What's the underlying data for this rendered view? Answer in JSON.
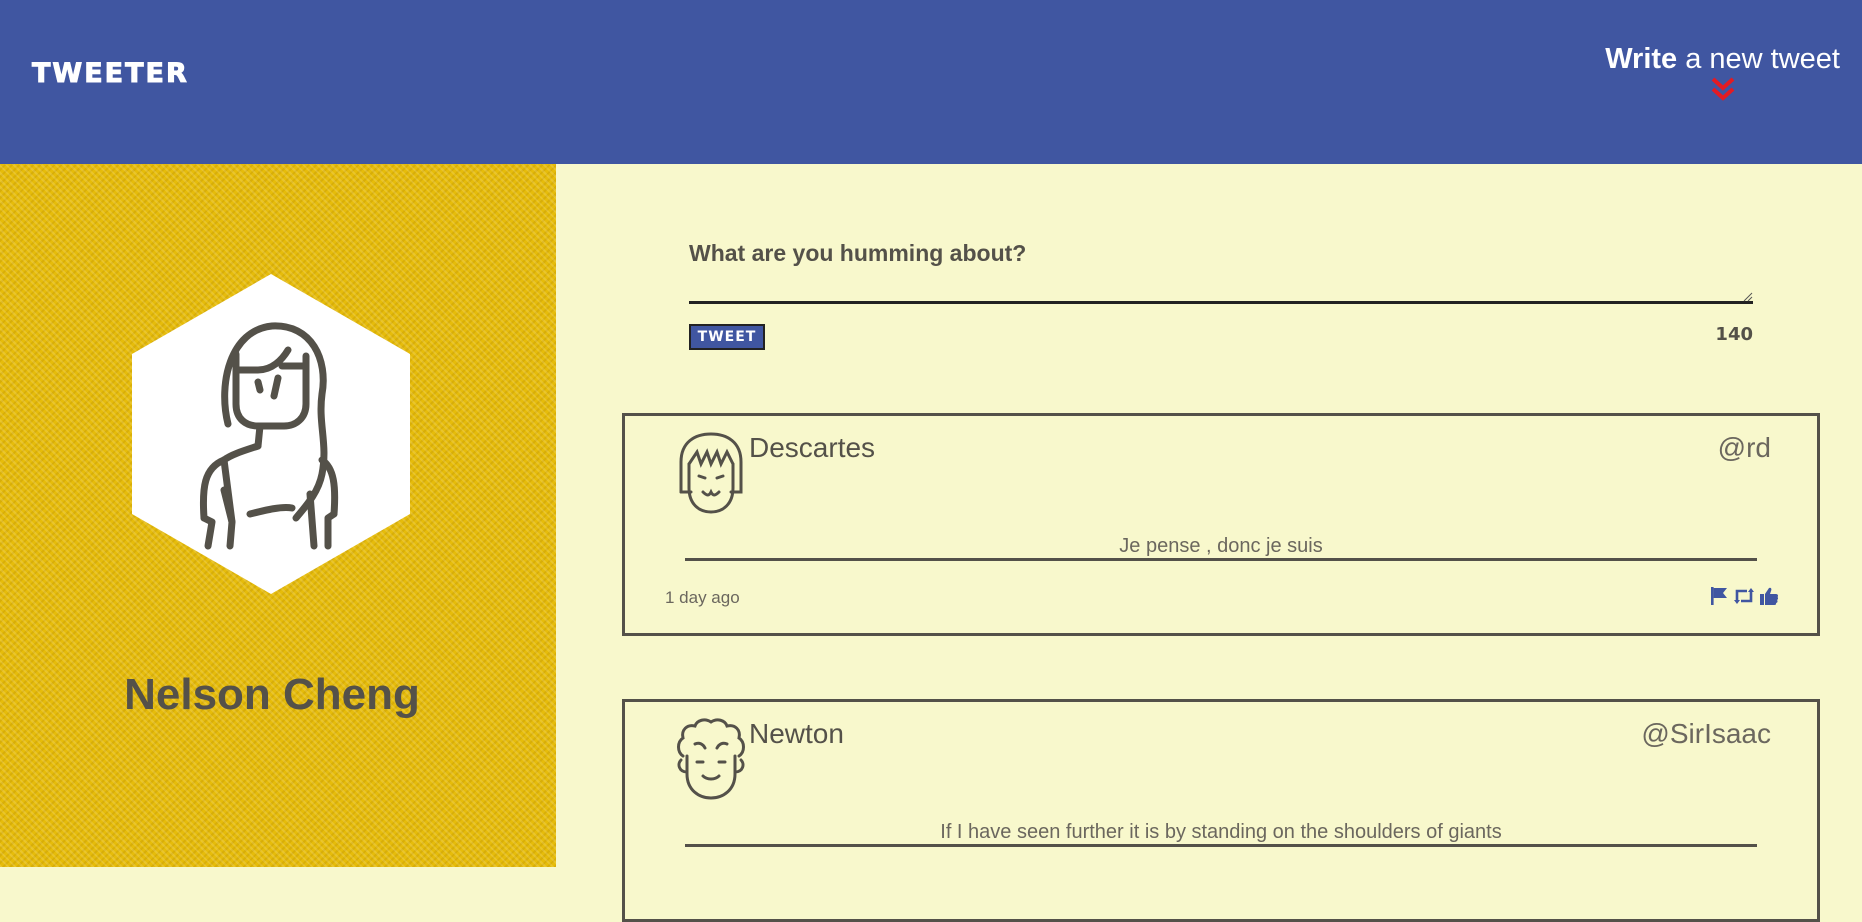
{
  "nav": {
    "brand": "TWEETER",
    "compose_bold": "Write",
    "compose_rest": " a new tweet",
    "chevron_icon": "double-chevron-down-icon",
    "chevron_color": "#e31b23",
    "background": "#4056a1"
  },
  "profile": {
    "name": "Nelson Cheng",
    "avatar_icon": "woman-avatar-icon",
    "background": "#e6bc0a"
  },
  "composer": {
    "label": "What are you humming about?",
    "textarea_value": "",
    "button_label": "TWEET",
    "counter": "140"
  },
  "tweets": [
    {
      "name": "Descartes",
      "handle": "@rd",
      "text": "Je pense , donc je suis",
      "time": "1 day ago",
      "avatar_icon": "girl-face-avatar-icon",
      "actions": [
        "flag-icon",
        "retweet-icon",
        "like-icon"
      ]
    },
    {
      "name": "Newton",
      "handle": "@SirIsaac",
      "text": "If I have seen further it is by standing on the shoulders of giants",
      "avatar_icon": "curly-hair-face-avatar-icon"
    }
  ],
  "colors": {
    "accent": "#4056a1",
    "text": "#545149",
    "background": "#f8f8cc"
  }
}
